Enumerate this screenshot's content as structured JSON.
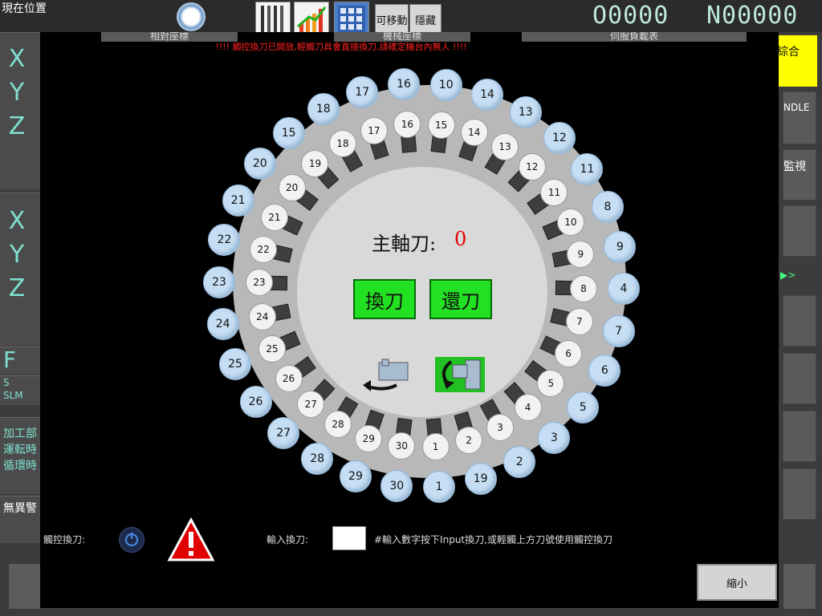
{
  "topbar": {
    "position_title": "現在位置",
    "movable_label": "可移動",
    "hide_label": "隱藏",
    "counter_o": "O0000",
    "counter_n": "N00000"
  },
  "header_tabs": [
    "相對座標",
    "機械座標",
    "伺服負載表"
  ],
  "warning": "!!!!   觸控換刀已開放,輕觸刀具會直接換刀,請確定機台內無人   !!!!",
  "left": {
    "axes1": [
      "X",
      "Y",
      "Z"
    ],
    "axes2": [
      "X",
      "Y",
      "Z"
    ],
    "feed": "F",
    "s": "S",
    "slm": "SLM",
    "info": [
      "加工部",
      "運転時",
      "循環時"
    ],
    "alarm": "無異警"
  },
  "right": {
    "tab_combined": "綜合",
    "handle": "NDLE",
    "monitor": "監視",
    "arrow": "▶>"
  },
  "magazine": {
    "inner_slots": [
      "1",
      "2",
      "3",
      "4",
      "5",
      "6",
      "7",
      "8",
      "9",
      "10",
      "11",
      "12",
      "13",
      "14",
      "15",
      "16",
      "17",
      "18",
      "19",
      "20",
      "21",
      "22",
      "23",
      "24",
      "25",
      "26",
      "27",
      "28",
      "29",
      "30"
    ],
    "outer_tools": [
      "1",
      "19",
      "2",
      "3",
      "5",
      "6",
      "7",
      "4",
      "9",
      "8",
      "11",
      "12",
      "13",
      "14",
      "10",
      "16",
      "17",
      "18",
      "15",
      "20",
      "21",
      "22",
      "23",
      "24",
      "25",
      "26",
      "27",
      "28",
      "29",
      "30"
    ]
  },
  "spindle": {
    "label": "主軸刀:",
    "value": "0"
  },
  "buttons": {
    "change": "換刀",
    "return": "還刀",
    "shrink": "縮小"
  },
  "bottom": {
    "touch_label": "觸控換刀:",
    "input_label": "輸入換刀:",
    "input_value": "",
    "hint": "#輸入數字按下Input換刀,或輕觸上方刀號使用觸控換刀"
  },
  "colors": {
    "accent_green": "#22e022",
    "warning_red": "#ff2020",
    "tool_blue": "#c6def4",
    "tab_yellow": "#ffff00"
  }
}
